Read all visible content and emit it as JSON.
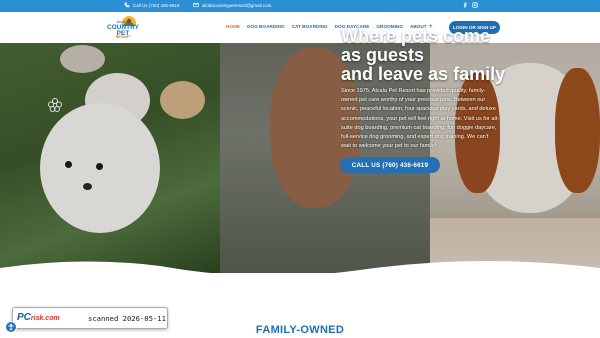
{
  "topbar": {
    "phone": "Call Us (760) 436-6619",
    "email": "alcalacountrypetresort@gmail.com",
    "colors": {
      "background": "#2b8fd6"
    },
    "social": [
      "facebook-icon",
      "instagram-icon"
    ]
  },
  "logo": {
    "top_text": "Alcala",
    "title_line1": "COUNTRY PET",
    "sub_text": "RESORT"
  },
  "nav": {
    "items": [
      "HOME",
      "DOG BOARDING",
      "CAT BOARDING",
      "DOG DAYCARE",
      "GROOMING",
      "ABOUT"
    ],
    "active": "HOME",
    "about_icon": "plus-icon",
    "login_label": "LOGIN OR SIGN UP",
    "colors": {
      "link": "#1f6fb0",
      "active": "#e0702a",
      "button": "#1f6fb0"
    }
  },
  "hero": {
    "title_line1": "Where pets come",
    "title_line2": "as guests",
    "title_line3": "and leave as family",
    "body": "Since 1975, Alcala Pet Resort has provided quality, family-owned pet care worthy of your precious pets. Between our scenic, peaceful location, four spacious play yards, and deluxe accommodations, your pet will feel right at home. Visit us for all-suite dog boarding, premium cat boarding, fun doggie daycare, full-service dog grooming, and expert dog training. We can't wait to welcome your pet to our family!",
    "cta_label": "CALL US (760) 436-6619",
    "colors": {
      "cta": "#2470b5"
    }
  },
  "section": {
    "heading": "FAMILY-OWNED"
  },
  "watermark": {
    "brand_pc": "PC",
    "brand_risk": "risk.com",
    "scan_text": "scanned 2026-05-11"
  },
  "accessibility": {
    "icon": "accessibility-icon"
  }
}
